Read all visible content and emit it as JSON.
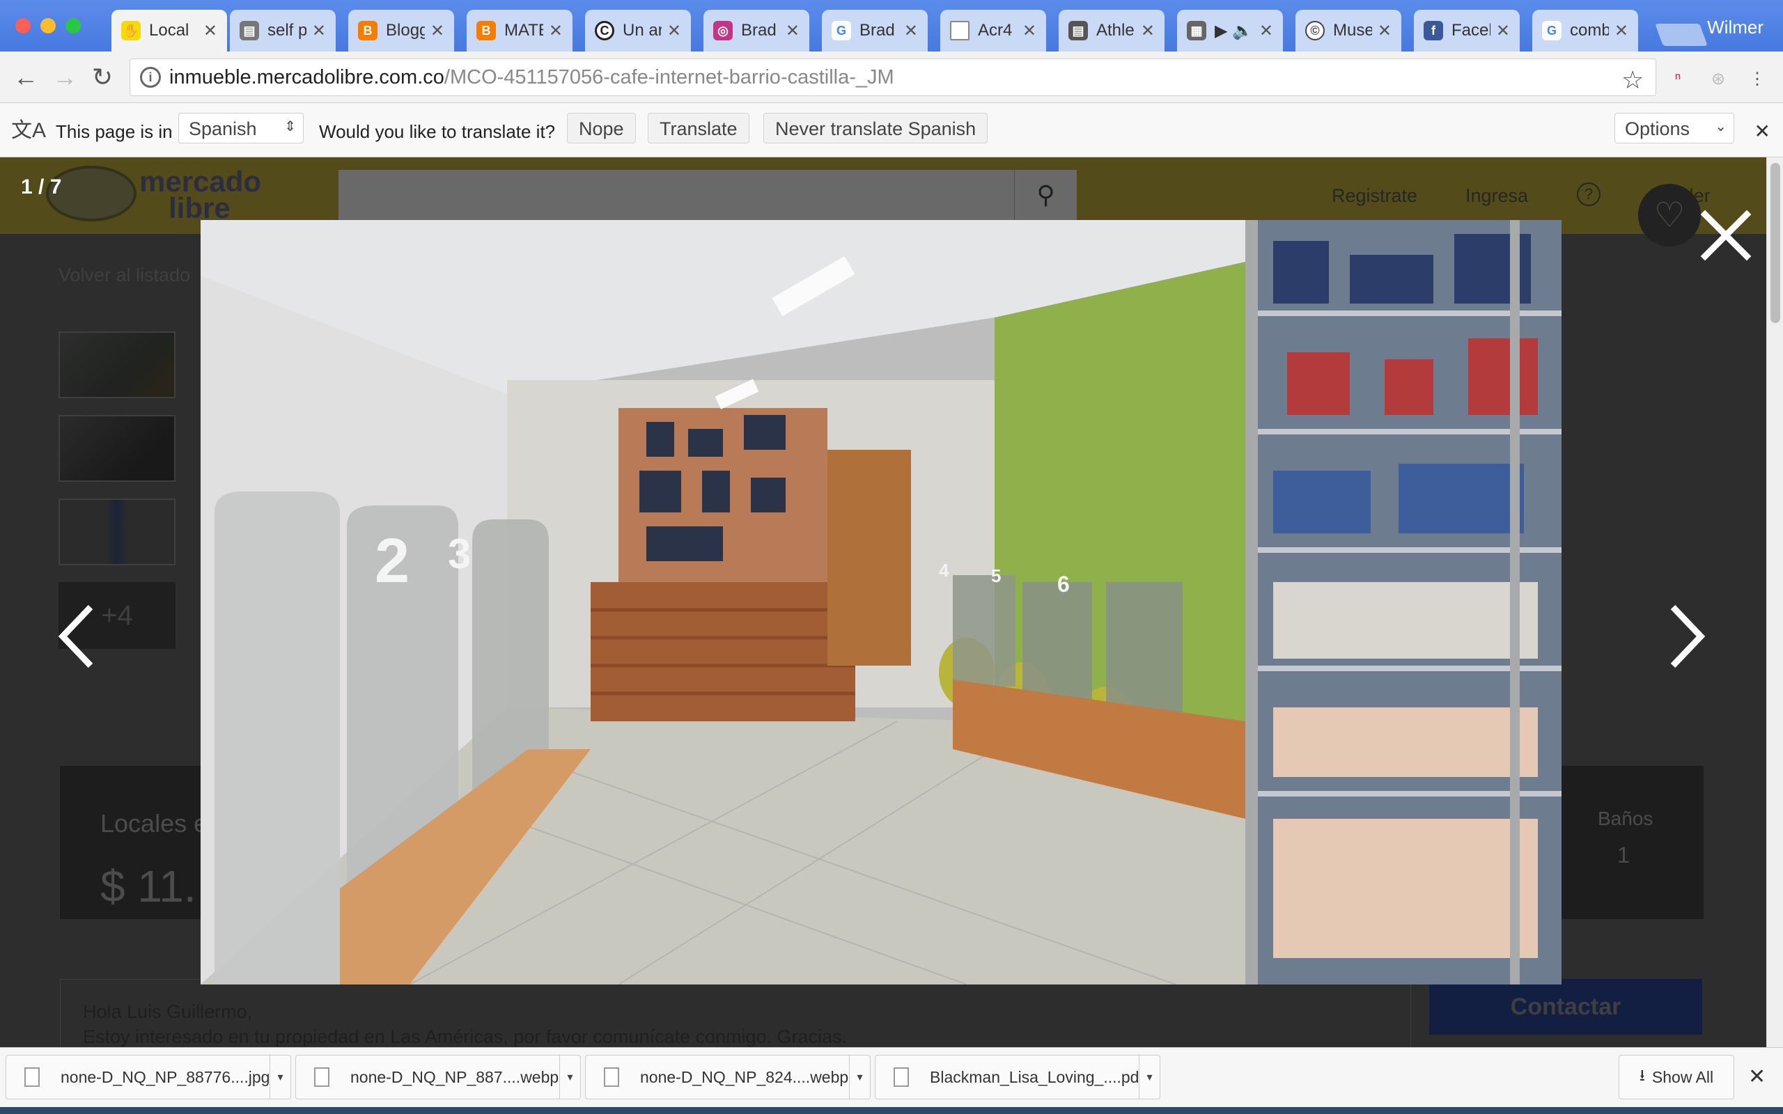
{
  "browser": {
    "profile_name": "Wilmer",
    "tabs": [
      {
        "title": "Local",
        "icon": "mercadolibre-icon",
        "color": "#f5d90a"
      },
      {
        "title": "self p",
        "icon": "image-favicon-icon",
        "color": "#777777"
      },
      {
        "title": "Blogg",
        "icon": "blogger-icon",
        "color": "#f57d00"
      },
      {
        "title": "MATE",
        "icon": "blogger-icon",
        "color": "#f57d00"
      },
      {
        "title": "Un ar",
        "icon": "c-logo-icon",
        "color": "#222222"
      },
      {
        "title": "Brad",
        "icon": "instagram-icon",
        "color": "#c13584"
      },
      {
        "title": "Brad",
        "icon": "google-icon",
        "color": "#4285f4"
      },
      {
        "title": "Acr4",
        "icon": "document-icon",
        "color": "#888888"
      },
      {
        "title": "Athle",
        "icon": "image-favicon-icon",
        "color": "#555555"
      },
      {
        "title": "",
        "icon": "media-favicon-icon",
        "color": "#666666"
      },
      {
        "title": "Muse",
        "icon": "copyright-icon",
        "color": "#444444"
      },
      {
        "title": "Faceb",
        "icon": "facebook-icon",
        "color": "#3b5998"
      },
      {
        "title": "comb",
        "icon": "google-icon",
        "color": "#4285f4"
      }
    ],
    "url_host": "inmueble.mercadolibre.com.co",
    "url_path": "/MCO-451157056-cafe-internet-barrio-castilla-_JM"
  },
  "translate_bar": {
    "prefix": "This page is in",
    "language": "Spanish",
    "question": "Would you like to translate it?",
    "nope": "Nope",
    "translate": "Translate",
    "never": "Never translate Spanish",
    "options": "Options"
  },
  "page": {
    "logo_line1": "mercado",
    "logo_line2": "libre",
    "nav": [
      "Registrate",
      "Ingresa",
      "?",
      "Vender"
    ],
    "back_link": "Volver al listado",
    "more_photos": "+4",
    "listing_title": "Locales e",
    "price": "$ 11.",
    "baths_label": "Baños",
    "baths_value": "1",
    "message_line1": "Hola Luis Guillermo,",
    "message_line2": "Estoy interesado en tu propiedad en Las Américas, por favor comunícate conmigo. Gracias.",
    "contact_button": "Contactar"
  },
  "lightbox": {
    "counter": "1 / 7",
    "desk_numbers": [
      "2",
      "3",
      "4",
      "5",
      "6"
    ]
  },
  "downloads": {
    "files": [
      "none-D_NQ_NP_88776....jpg",
      "none-D_NQ_NP_887....webp",
      "none-D_NQ_NP_824....webp",
      "Blackman_Lisa_Loving_....pdf"
    ],
    "show_all": "Show All"
  }
}
